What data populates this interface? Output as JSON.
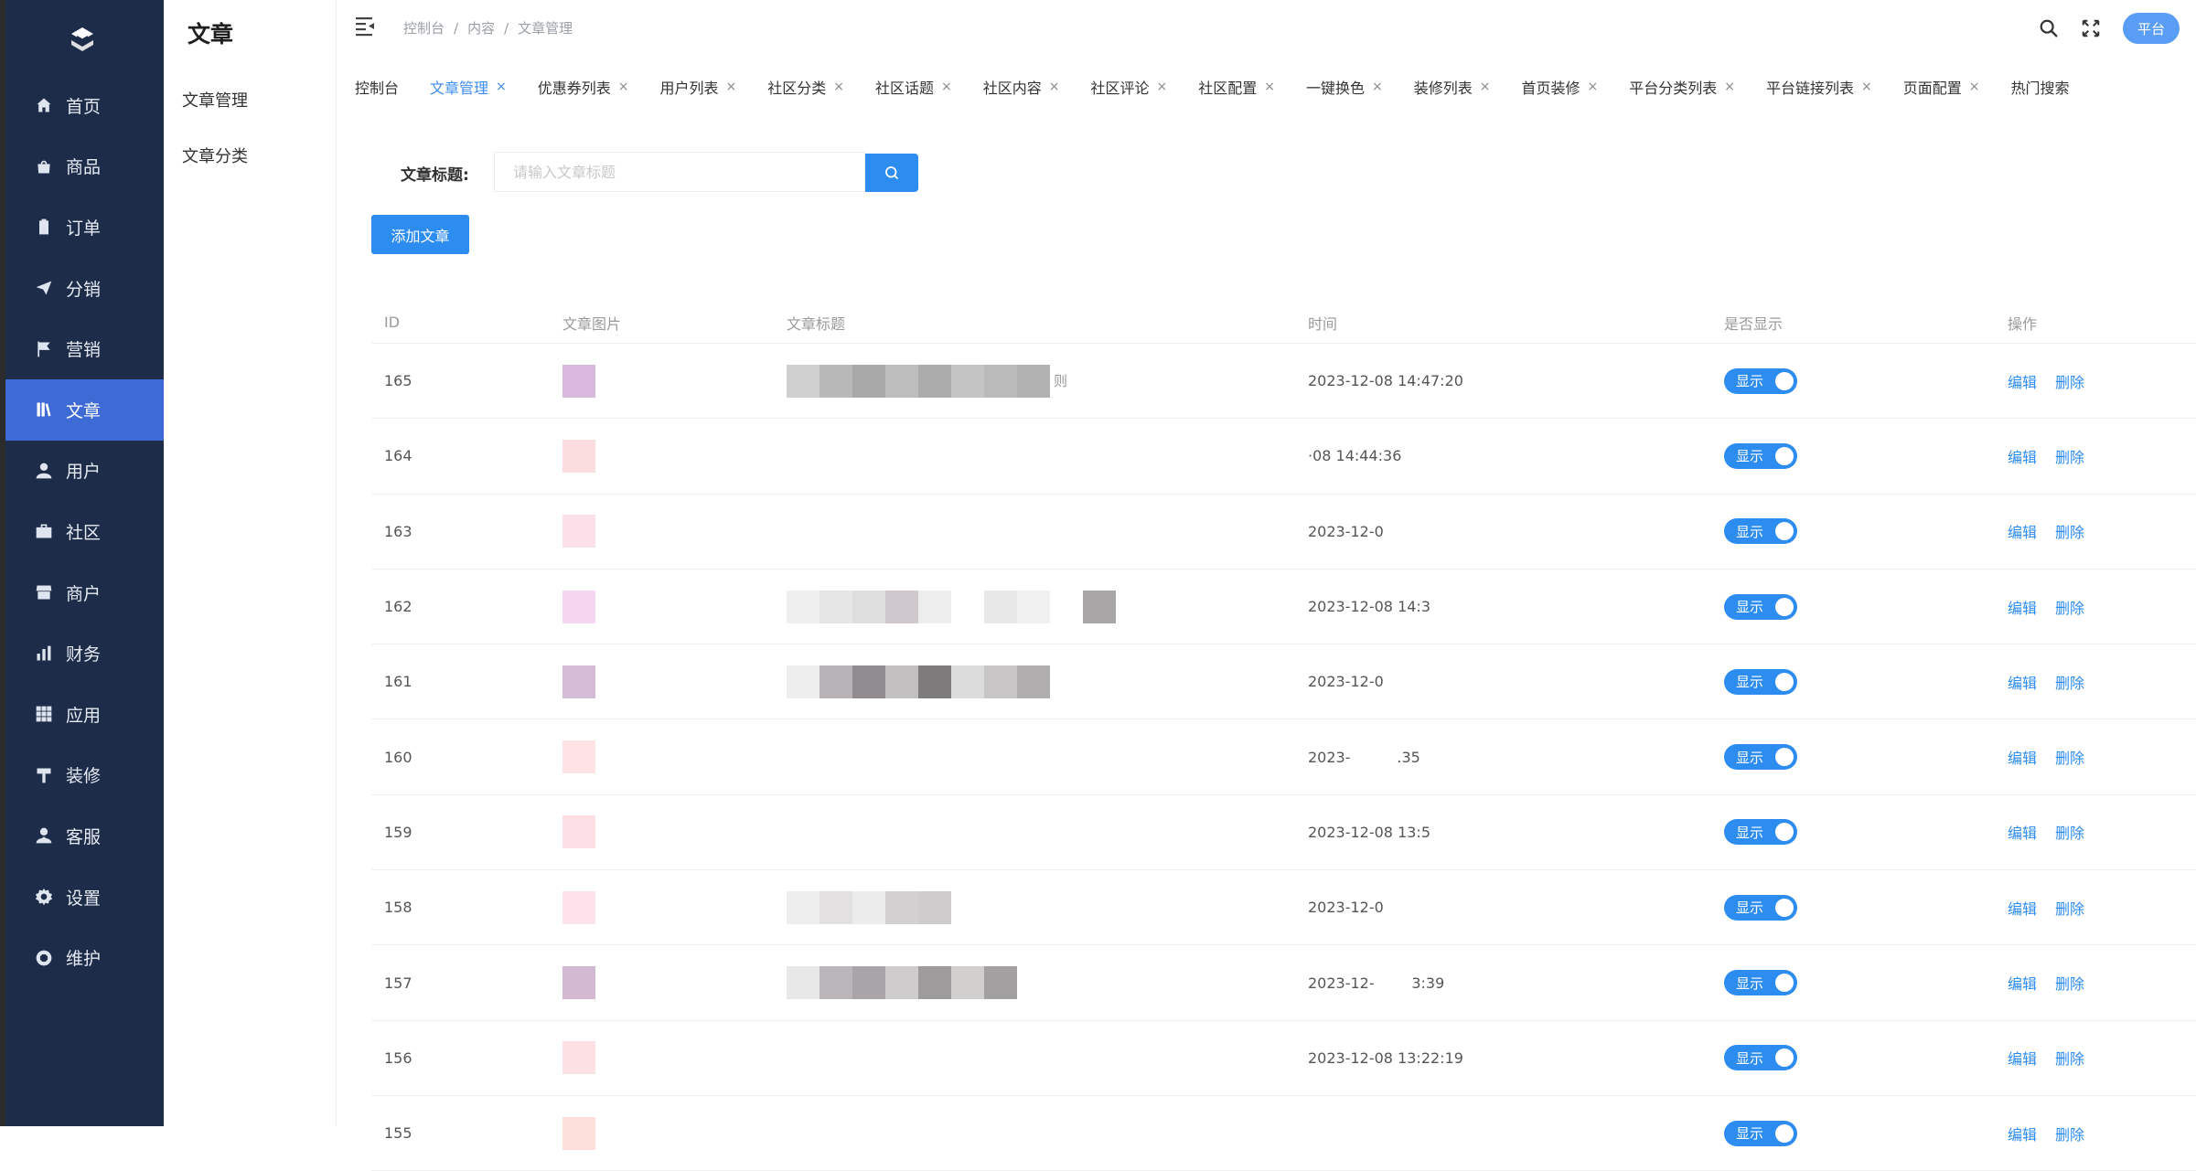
{
  "sidebar": {
    "items": [
      {
        "label": "首页",
        "icon": "home-icon",
        "active": false
      },
      {
        "label": "商品",
        "icon": "bag-icon",
        "active": false
      },
      {
        "label": "订单",
        "icon": "clipboard-icon",
        "active": false
      },
      {
        "label": "分销",
        "icon": "send-icon",
        "active": false
      },
      {
        "label": "营销",
        "icon": "flag-icon",
        "active": false
      },
      {
        "label": "文章",
        "icon": "book-icon",
        "active": true
      },
      {
        "label": "用户",
        "icon": "user-icon",
        "active": false
      },
      {
        "label": "社区",
        "icon": "briefcase-icon",
        "active": false
      },
      {
        "label": "商户",
        "icon": "store-icon",
        "active": false
      },
      {
        "label": "财务",
        "icon": "chart-icon",
        "active": false
      },
      {
        "label": "应用",
        "icon": "grid-icon",
        "active": false
      },
      {
        "label": "装修",
        "icon": "paint-icon",
        "active": false
      },
      {
        "label": "客服",
        "icon": "headset-icon",
        "active": false
      },
      {
        "label": "设置",
        "icon": "gear-icon",
        "active": false
      },
      {
        "label": "维护",
        "icon": "lifebuoy-icon",
        "active": false
      }
    ]
  },
  "subpanel": {
    "title": "文章",
    "items": [
      "文章管理",
      "文章分类"
    ]
  },
  "breadcrumb": [
    "控制台",
    "内容",
    "文章管理"
  ],
  "header": {
    "avatar_label": "平台"
  },
  "tabs": [
    {
      "label": "控制台",
      "closable": false,
      "active": false
    },
    {
      "label": "文章管理",
      "closable": true,
      "active": true
    },
    {
      "label": "优惠券列表",
      "closable": true,
      "active": false
    },
    {
      "label": "用户列表",
      "closable": true,
      "active": false
    },
    {
      "label": "社区分类",
      "closable": true,
      "active": false
    },
    {
      "label": "社区话题",
      "closable": true,
      "active": false
    },
    {
      "label": "社区内容",
      "closable": true,
      "active": false
    },
    {
      "label": "社区评论",
      "closable": true,
      "active": false
    },
    {
      "label": "社区配置",
      "closable": true,
      "active": false
    },
    {
      "label": "一键换色",
      "closable": true,
      "active": false
    },
    {
      "label": "装修列表",
      "closable": true,
      "active": false
    },
    {
      "label": "首页装修",
      "closable": true,
      "active": false
    },
    {
      "label": "平台分类列表",
      "closable": true,
      "active": false
    },
    {
      "label": "平台链接列表",
      "closable": true,
      "active": false
    },
    {
      "label": "页面配置",
      "closable": true,
      "active": false
    },
    {
      "label": "热门搜索",
      "closable": false,
      "active": false
    }
  ],
  "tab_close_glyph": "×",
  "search": {
    "label": "文章标题:",
    "placeholder": "请输入文章标题",
    "value": ""
  },
  "add_button": "添加文章",
  "table": {
    "headers": [
      "ID",
      "文章图片",
      "文章标题",
      "时间",
      "是否显示",
      "操作"
    ],
    "rows": [
      {
        "id": "165",
        "thumb": "#d8b8dc",
        "title_tail": "则",
        "title_blocks": [
          "#cfcfcf",
          "#b8b8b8",
          "#a8a8a8",
          "#bdbdbd",
          "#acacac",
          "#c4c4c4",
          "#bababa",
          "#b1b1b1"
        ],
        "time": "2023-12-08 14:47:20",
        "show": "显示"
      },
      {
        "id": "164",
        "thumb": "#fbdde0",
        "title_tail": "",
        "title_blocks": [],
        "time": "·08 14:44:36",
        "show": "显示"
      },
      {
        "id": "163",
        "thumb": "#fbe0ea",
        "title_tail": "",
        "title_blocks": [],
        "time": "2023-12-0",
        "show": "显示"
      },
      {
        "id": "162",
        "thumb": "#f5d6f0",
        "title_tail": "",
        "title_blocks": [
          "#efefef",
          "#e6e6e6",
          "#dedede",
          "#cfc8cc",
          "#ededed",
          "#ffffff",
          "#e8e8e8",
          "#f0f0f0",
          "#ffffff",
          "#a9a6a8"
        ],
        "time": "2023-12-08 14:3",
        "show": "显示"
      },
      {
        "id": "161",
        "thumb": "#d4bcd6",
        "title_tail": "",
        "title_blocks": [
          "#eeeeee",
          "#b6b2b5",
          "#8f8b8e",
          "#c2bfc1",
          "#7e7b7d",
          "#dcdcdc",
          "#c9c6c8",
          "#b0adaf"
        ],
        "time": "2023-12-0",
        "show": "显示"
      },
      {
        "id": "160",
        "thumb": "#fde2e6",
        "title_tail": "",
        "title_blocks": [],
        "time": "2023-          .35",
        "show": "显示"
      },
      {
        "id": "159",
        "thumb": "#fde0e6",
        "title_tail": "",
        "title_blocks": [],
        "time": "2023-12-08 13:5",
        "show": "显示"
      },
      {
        "id": "158",
        "thumb": "#fde2ec",
        "title_tail": "",
        "title_blocks": [
          "#eeeeee",
          "#e2e0e1",
          "#ececec",
          "#d3d0d2",
          "#cfcccd"
        ],
        "time": "2023-12-0",
        "show": "显示"
      },
      {
        "id": "157",
        "thumb": "#d2b8d0",
        "title_tail": "",
        "title_blocks": [
          "#e8e8e8",
          "#b9b5b8",
          "#a8a4a7",
          "#cfcccd",
          "#9e9b9d",
          "#d1cece",
          "#a3a0a2"
        ],
        "time": "2023-12-        3:39",
        "show": "显示"
      },
      {
        "id": "156",
        "thumb": "#fde0e4",
        "title_tail": "",
        "title_blocks": [],
        "time": "2023-12-08 13:22:19",
        "show": "显示"
      },
      {
        "id": "155",
        "thumb": "#fde0dc",
        "title_tail": "",
        "title_blocks": [],
        "time": "",
        "show": "显示"
      }
    ],
    "op_edit": "编辑",
    "op_delete": "删除"
  },
  "colors": {
    "sidebar_bg": "#1d2c48",
    "active_bg": "#3e6ad6",
    "primary": "#2d8cf0"
  }
}
